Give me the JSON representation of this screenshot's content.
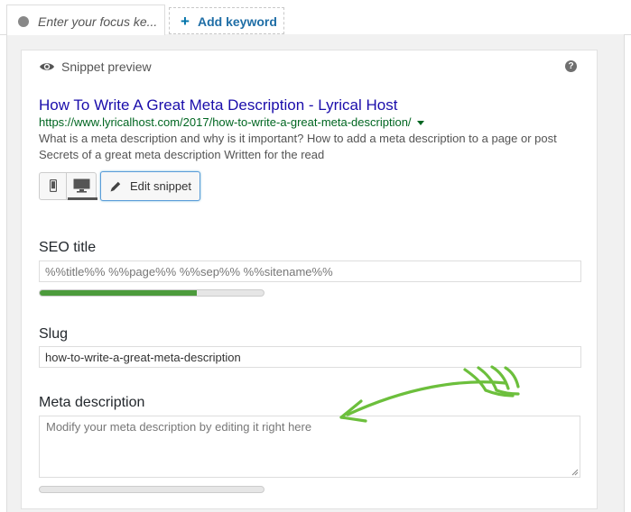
{
  "tabs": {
    "focus_keyword_placeholder": "Enter your focus ke...",
    "add_keyword_label": "Add keyword",
    "add_keyword_icon": "plus-icon"
  },
  "snippet_preview": {
    "label": "Snippet preview",
    "eye_icon": "eye-icon",
    "help_icon_text": "?",
    "title": "How To Write A Great Meta Description - Lyrical Host",
    "url": "https://www.lyricalhost.com/2017/how-to-write-a-great-meta-description/",
    "description": "What is a meta description and why is it important? How to add a meta description to a page or post Secrets of a great meta description Written for the read",
    "device_modes": [
      "mobile",
      "desktop"
    ],
    "active_device": "desktop",
    "edit_button_label": "Edit snippet"
  },
  "fields": {
    "seo_title": {
      "label": "SEO title",
      "value": "%%title%% %%page%% %%sep%% %%sitename%%",
      "progress": 0.7,
      "progress_color": "#4c9b3c"
    },
    "slug": {
      "label": "Slug",
      "value": "how-to-write-a-great-meta-description"
    },
    "meta_description": {
      "label": "Meta description",
      "placeholder": "Modify your meta description by editing it right here",
      "progress": 0
    }
  },
  "colors": {
    "title_link": "#1a0dab",
    "url_green": "#006621",
    "accent_blue": "#0073aa",
    "annotation_arrow": "#6cbf3c"
  }
}
